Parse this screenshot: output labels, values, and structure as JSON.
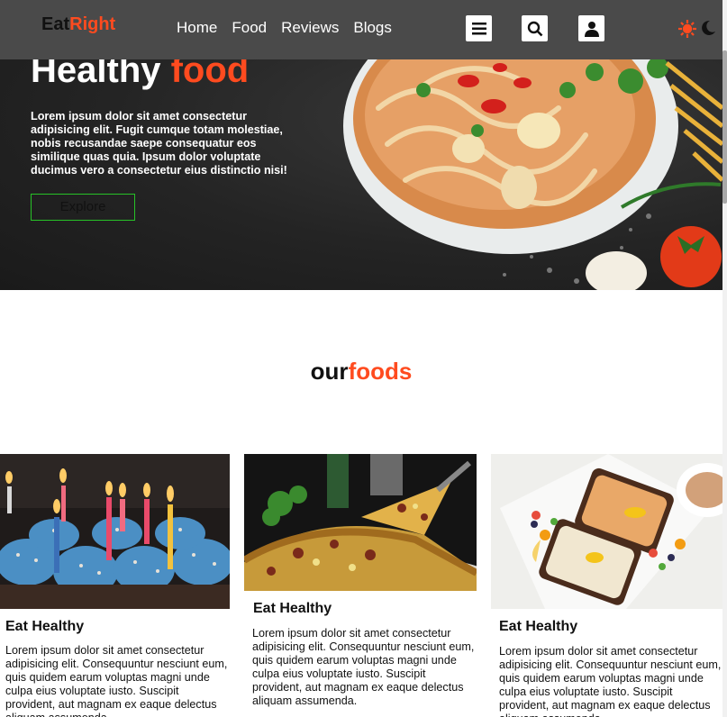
{
  "header": {
    "logo_part1": "Eat",
    "logo_part2": "Right",
    "nav": [
      "Home",
      "Food",
      "Reviews",
      "Blogs"
    ],
    "icons": [
      "menu-icon",
      "search-icon",
      "user-icon",
      "sun-icon",
      "moon-icon"
    ]
  },
  "hero": {
    "title_part1": "Healthy ",
    "title_part2": "food",
    "text": "Lorem ipsum dolor sit amet consectetur adipisicing elit. Fugit cumque totam molestiae, nobis recusandae saepe consequatur eos similique quas quia. Ipsum dolor voluptate ducimus vero a consectetur eius distinctio nisi!",
    "button_label": "Explore"
  },
  "section": {
    "title_part1": "our",
    "title_part2": "foods"
  },
  "cards": [
    {
      "title": "Eat Healthy",
      "text": "Lorem ipsum dolor sit amet consectetur adipisicing elit. Consequuntur nesciunt eum, quis quidem earum voluptas magni unde culpa eius voluptate iusto. Suscipit provident, aut magnam ex eaque delectus aliquam assumenda."
    },
    {
      "title": "Eat Healthy",
      "text": "Lorem ipsum dolor sit amet consectetur adipisicing elit. Consequuntur nesciunt eum, quis quidem earum voluptas magni unde culpa eius voluptate iusto. Suscipit provident, aut magnam ex eaque delectus aliquam assumenda."
    },
    {
      "title": "Eat Healthy",
      "text": "Lorem ipsum dolor sit amet consectetur adipisicing elit. Consequuntur nesciunt eum, quis quidem earum voluptas magni unde culpa eius voluptate iusto. Suscipit provident, aut magnam ex eaque delectus aliquam assumenda."
    }
  ],
  "colors": {
    "accent": "#ff4b1f",
    "header_bg": "#4a4a4a",
    "button_border": "#27c227"
  }
}
